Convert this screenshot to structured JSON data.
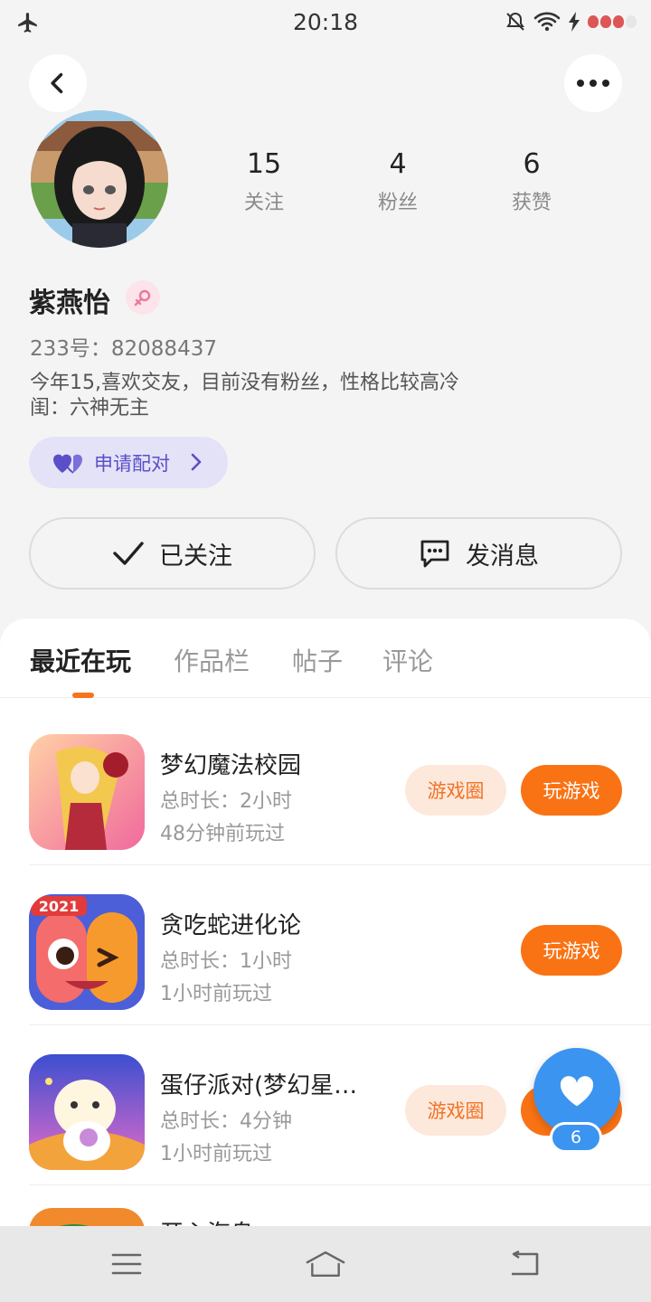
{
  "status_bar": {
    "time": "20:18"
  },
  "profile": {
    "stats": [
      {
        "value": "15",
        "label": "关注"
      },
      {
        "value": "4",
        "label": "粉丝"
      },
      {
        "value": "6",
        "label": "获赞"
      }
    ],
    "name": "紫燕怡",
    "uid": "233号：82088437",
    "bio_line1": "今年15,喜欢交友，目前没有粉丝，性格比较高冷",
    "bio_line2": "闺：六神无主",
    "pair_label": "申请配对",
    "follow_label": "已关注",
    "message_label": "发消息"
  },
  "tabs": [
    "最近在玩",
    "作品栏",
    "帖子",
    "评论"
  ],
  "games": [
    {
      "title": "梦幻魔法校园",
      "duration": "总时长：2小时",
      "last_played": "48分钟前玩过",
      "circle_label": "游戏圈",
      "play_label": "玩游戏",
      "badge": ""
    },
    {
      "title": "贪吃蛇进化论",
      "duration": "总时长：1小时",
      "last_played": "1小时前玩过",
      "circle_label": "",
      "play_label": "玩游戏",
      "badge": "2021"
    },
    {
      "title": "蛋仔派对(梦幻星…",
      "duration": "总时长：4分钟",
      "last_played": "1小时前玩过",
      "circle_label": "游戏圈",
      "play_label": "",
      "badge": ""
    },
    {
      "title": "开心海岛"
    }
  ],
  "floating_like": {
    "count": "6"
  },
  "colors": {
    "accent": "#f97314",
    "like": "#3b94f0",
    "pair": "#5a4fc8"
  }
}
